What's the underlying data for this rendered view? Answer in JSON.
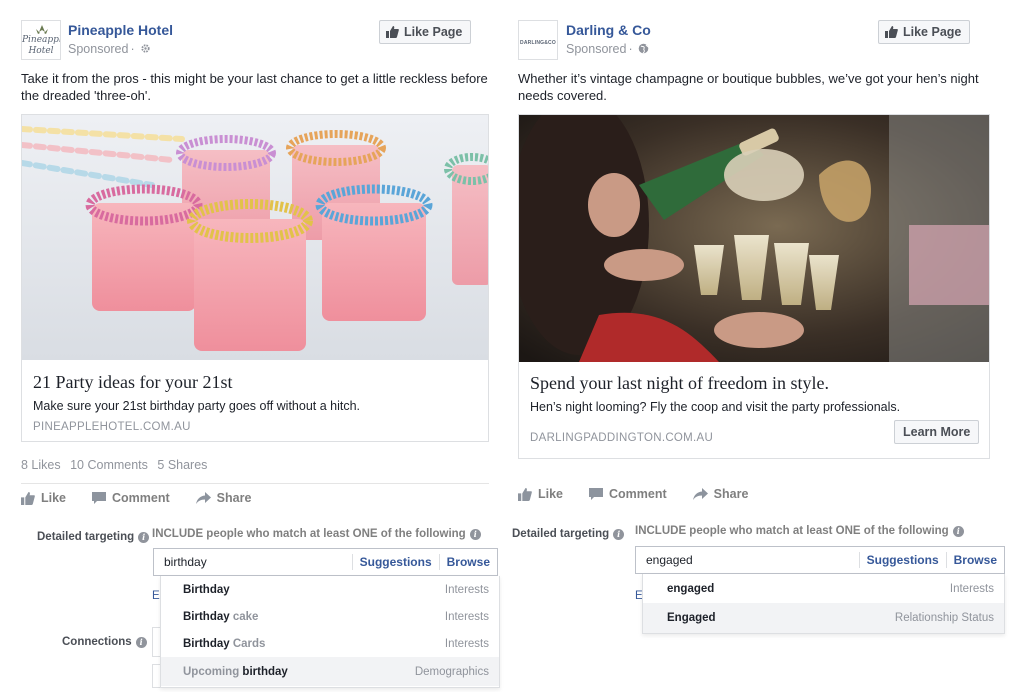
{
  "left_ad": {
    "page_name": "Pineapple Hotel",
    "avatar_text": [
      "Pineapple",
      "Hotel"
    ],
    "sponsored": "Sponsored",
    "sponsored_icon": "gear-icon",
    "like_page": "Like Page",
    "post_text_lines": [
      "Take it from the pros - this might be your last chance to get a little reckless before",
      "the dreaded 'three-oh'."
    ],
    "photo_desc": "pink-shots-with-sprinkles",
    "card_title": "21 Party ideas for your 21st",
    "card_desc": "Make sure your 21st birthday party goes off without a hitch.",
    "card_domain": "PINEAPPLEHOTEL.COM.AU",
    "stats": {
      "likes": "8 Likes",
      "comments": "10 Comments",
      "shares": "5 Shares"
    },
    "actions": {
      "like": "Like",
      "comment": "Comment",
      "share": "Share"
    },
    "targeting": {
      "label": "Detailed targeting",
      "include": "INCLUDE people who match at least ONE of the following",
      "search_value": "birthday",
      "suggestions": "Suggestions",
      "browse": "Browse",
      "e_letter": "E",
      "connections_label": "Connections",
      "results": [
        {
          "bold": "Birthday",
          "light": "",
          "prefix": "",
          "type": "Interests"
        },
        {
          "bold": "Birthday",
          "light": " cake",
          "prefix": "",
          "type": "Interests"
        },
        {
          "bold": "Birthday",
          "light": " Cards",
          "prefix": "",
          "type": "Interests"
        },
        {
          "bold": "birthday",
          "light": "",
          "prefix": "Upcoming ",
          "type": "Demographics"
        }
      ]
    }
  },
  "right_ad": {
    "page_name": "Darling & Co",
    "avatar_text": "DARLING&CO",
    "sponsored": "Sponsored",
    "sponsored_icon": "globe-icon",
    "like_page": "Like Page",
    "post_text_lines": [
      "Whether it’s vintage champagne or boutique bubbles, we’ve got your hen’s night",
      "needs covered."
    ],
    "photo_desc": "champagne-party",
    "card_title": "Spend your last night of freedom in style.",
    "card_desc": "Hen’s night looming? Fly the coop and visit the party professionals.",
    "card_domain": "DARLINGPADDINGTON.COM.AU",
    "learn_more": "Learn More",
    "actions": {
      "like": "Like",
      "comment": "Comment",
      "share": "Share"
    },
    "targeting": {
      "label": "Detailed targeting",
      "include": "INCLUDE people who match at least ONE of the following",
      "search_value": "engaged",
      "suggestions": "Suggestions",
      "browse": "Browse",
      "e_letter": "E",
      "results": [
        {
          "bold": "engaged",
          "type": "Interests"
        },
        {
          "bold": "Engaged",
          "type": "Relationship Status"
        }
      ]
    }
  },
  "colors": {
    "link": "#365899",
    "muted": "#90949c",
    "border": "#dddfe2",
    "button_bg": "#f6f7f9"
  }
}
